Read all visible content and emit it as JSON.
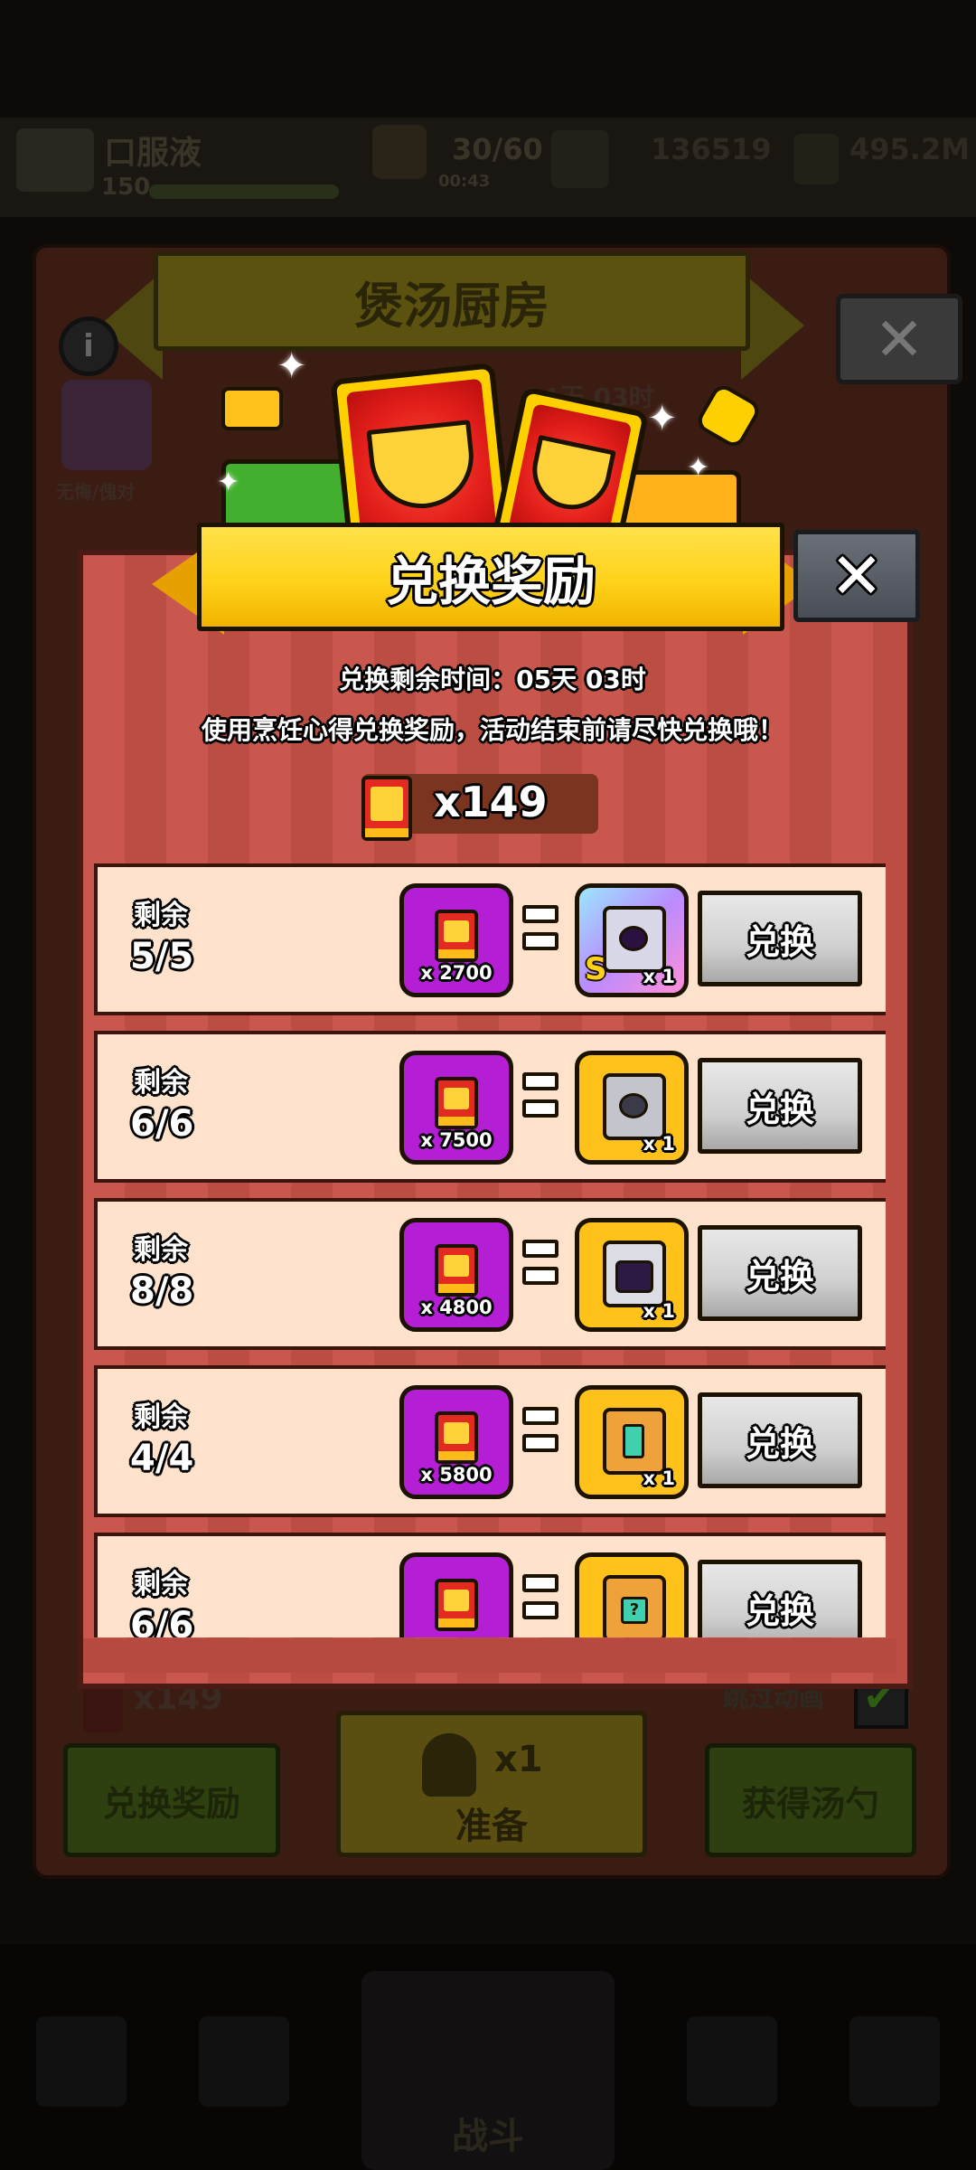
{
  "background": {
    "player_name": "口服液",
    "player_level": "150",
    "stamina": "30/60",
    "stamina_timer": "00:43",
    "coins": "136519",
    "power": "495.2M",
    "kitchen_title": "煲汤厨房",
    "kitchen_timer": "04天 03时",
    "character_label": "无悔/傀对",
    "bottom_balance": "x149",
    "skip_animation": "跳过动画",
    "redeem_button": "兑换奖励",
    "ladle_count": "x1",
    "prepare_button": "准备",
    "get_ladle_button": "获得汤勺",
    "nav_center_label": "战斗"
  },
  "modal": {
    "title": "兑换奖励",
    "remaining_time_text": "兑换剩余时间：05天 03时",
    "instruction_text": "使用烹饪心得兑换奖励，活动结束前请尽快兑换哦！",
    "balance": "x149",
    "rows": [
      {
        "label": "剩余",
        "count": "5/5",
        "cost": "x 2700",
        "reward_qty": "x 1",
        "reward_icon": "s-rank-robot-chest-icon",
        "button": "兑换"
      },
      {
        "label": "剩余",
        "count": "6/6",
        "cost": "x 7500",
        "reward_qty": "x 1",
        "reward_icon": "robot-chest-icon",
        "button": "兑换"
      },
      {
        "label": "剩余",
        "count": "8/8",
        "cost": "x 4800",
        "reward_qty": "x 1",
        "reward_icon": "purple-robot-chest-icon",
        "button": "兑换"
      },
      {
        "label": "剩余",
        "count": "4/4",
        "cost": "x 5800",
        "reward_qty": "x 1",
        "reward_icon": "treasure-chest-icon",
        "button": "兑换"
      },
      {
        "label": "剩余",
        "count": "6/6",
        "cost": "",
        "reward_qty": "",
        "reward_icon": "mystery-chest-icon",
        "button": "兑换"
      }
    ]
  },
  "colors": {
    "modal_stripe": "#c9574d",
    "row_bg": "#ffe2cb",
    "cost_tile": "#b41fd6",
    "reward_tile": "#ffc21a",
    "ribbon": "#ffd21a"
  }
}
